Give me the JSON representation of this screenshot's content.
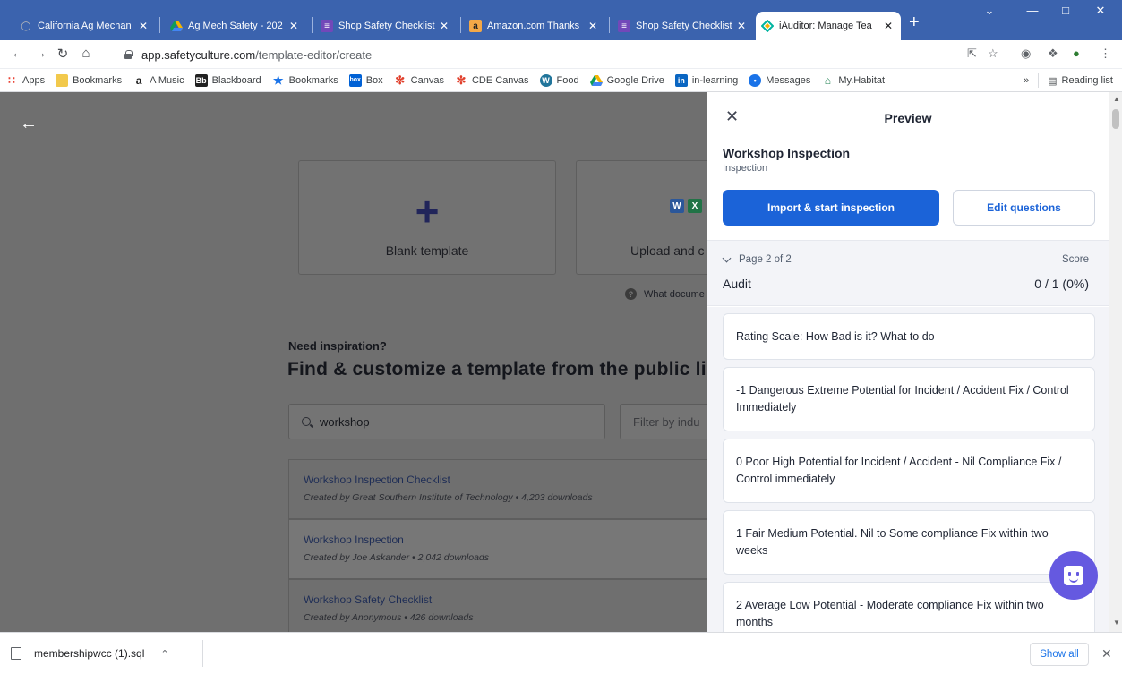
{
  "browser": {
    "tabs": [
      {
        "title": "California Ag Mechan",
        "icon": "puzzle-icon",
        "color": "#9a9a9a"
      },
      {
        "title": "Ag Mech Safety - 202",
        "icon": "google-drive-icon",
        "color": "#f4b400"
      },
      {
        "title": "Shop Safety Checklist",
        "icon": "google-forms-icon",
        "color": "#7248b9"
      },
      {
        "title": "Amazon.com Thanks",
        "icon": "amazon-icon",
        "color": "#f3a847"
      },
      {
        "title": "Shop Safety Checklist",
        "icon": "google-forms-icon",
        "color": "#7248b9"
      },
      {
        "title": "iAuditor: Manage Tea",
        "icon": "safetyculture-icon",
        "color": "#00b4a0"
      }
    ],
    "url_host": "app.safetyculture.com",
    "url_path": "/template-editor/create",
    "bookmarks": [
      {
        "label": "Apps",
        "icon": "apps-grid-icon",
        "color": "#ea4335"
      },
      {
        "label": "Bookmarks",
        "icon": "folder-icon",
        "color": "#f2c94c"
      },
      {
        "label": "A Music",
        "icon": "amazon-music-icon",
        "color": "#222222"
      },
      {
        "label": "Blackboard",
        "icon": "blackboard-icon",
        "color": "#222222"
      },
      {
        "label": "Bookmarks",
        "icon": "star-icon",
        "color": "#1a73e8"
      },
      {
        "label": "Box",
        "icon": "box-icon",
        "color": "#0061d5"
      },
      {
        "label": "Canvas",
        "icon": "canvas-icon",
        "color": "#e13f2b"
      },
      {
        "label": "CDE Canvas",
        "icon": "canvas-icon",
        "color": "#e13f2b"
      },
      {
        "label": "Food",
        "icon": "wordpress-icon",
        "color": "#21759b"
      },
      {
        "label": "Google Drive",
        "icon": "google-drive-icon",
        "color": "#0f9d58"
      },
      {
        "label": "in-learning",
        "icon": "linkedin-icon",
        "color": "#0a66c2"
      },
      {
        "label": "Messages",
        "icon": "messages-icon",
        "color": "#1a73e8"
      },
      {
        "label": "My.Habitat",
        "icon": "habitat-icon",
        "color": "#1b7f4f"
      }
    ],
    "reading_list": "Reading list",
    "more_chevrons": "»"
  },
  "page": {
    "cards": [
      {
        "label": "Blank template"
      },
      {
        "label": "Upload and c"
      }
    ],
    "what_docs": "What docume",
    "need_inspiration": "Need inspiration?",
    "find_heading": "Find & customize a template from the public lib",
    "search_value": "workshop",
    "filter_placeholder": "Filter by indu",
    "results": [
      {
        "title": "Workshop Inspection Checklist",
        "subtitle": "Created by Great Southern Institute of Technology  • 4,203 downloads"
      },
      {
        "title": "Workshop Inspection",
        "subtitle": "Created by Joe Askander  • 2,042 downloads"
      },
      {
        "title": "Workshop Safety Checklist",
        "subtitle": "Created by Anonymous  • 426 downloads"
      }
    ]
  },
  "preview": {
    "title": "Preview",
    "template_name": "Workshop Inspection",
    "template_type": "Inspection",
    "primary_button": "Import & start inspection",
    "secondary_button": "Edit questions",
    "page_label": "Page 2 of 2",
    "score_label": "Score",
    "section": "Audit",
    "score_value": "0 / 1 (0%)",
    "questions": [
      "Rating Scale: How Bad is it? What to do",
      "-1  Dangerous Extreme Potential for Incident / Accident Fix / Control Immediately",
      "0  Poor High Potential for Incident / Accident - Nil Compliance Fix / Control immediately",
      "1  Fair Medium Potential. Nil to Some compliance Fix within two weeks",
      "2  Average Low Potential - Moderate compliance Fix within two months"
    ]
  },
  "downloads": {
    "file": "membershipwcc (1).sql",
    "show_all": "Show all"
  },
  "colors": {
    "chrome_blue": "#3b63ae",
    "primary": "#1b63d8",
    "chat": "#6559e0",
    "overlay": "#6f6f6f"
  }
}
